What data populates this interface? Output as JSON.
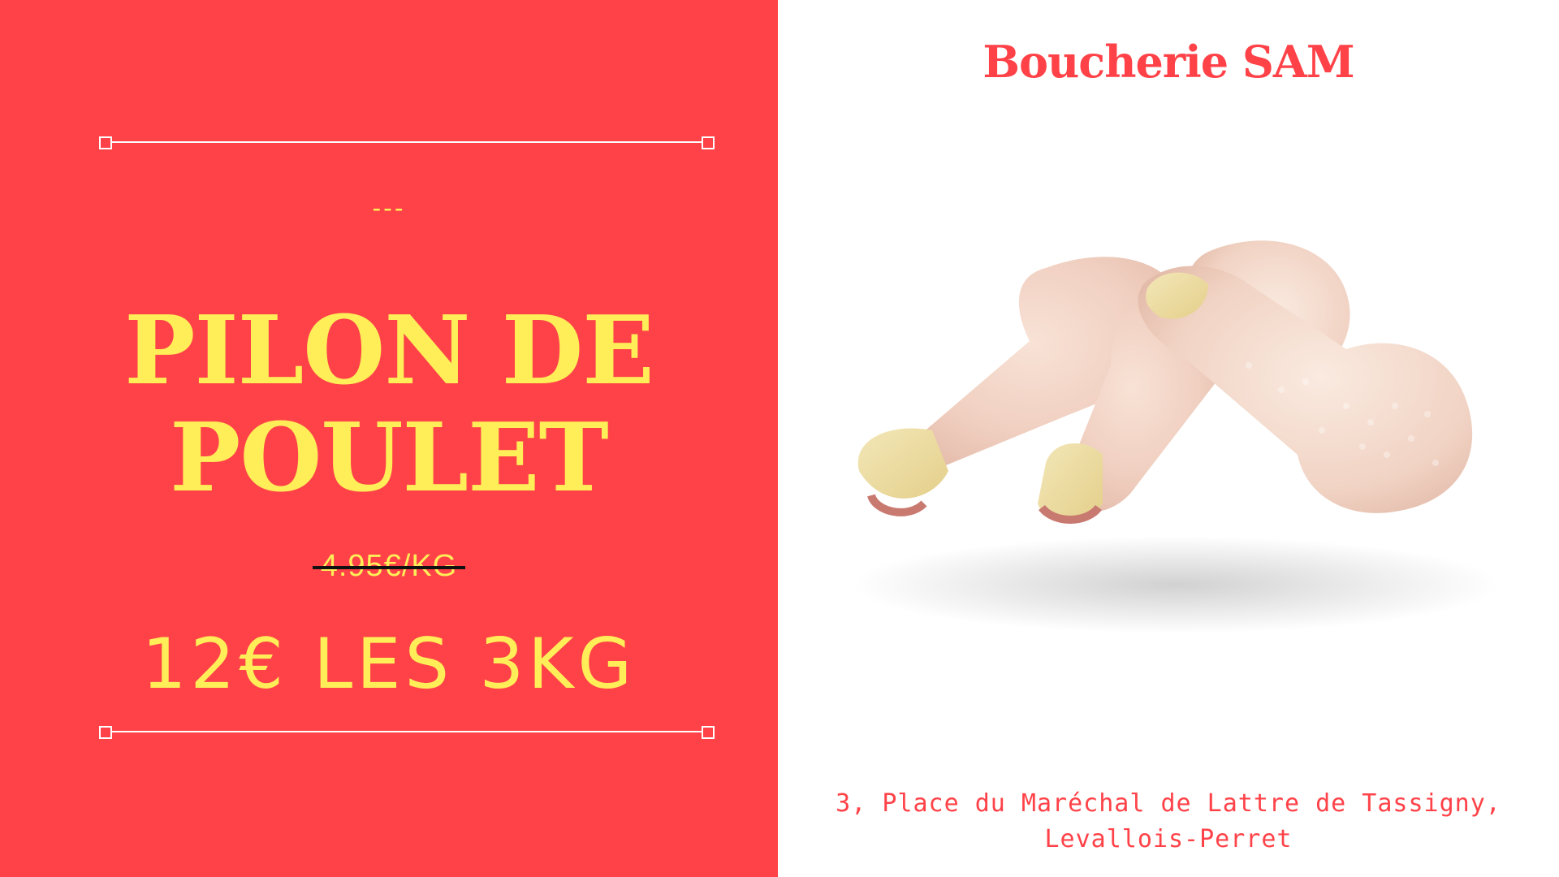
{
  "promo": {
    "dashes": "---",
    "title_line1": "PILON DE",
    "title_line2": "POULET",
    "old_price": "4.95€/KG",
    "new_price": "12€ LES 3KG"
  },
  "shop": {
    "name": "Boucherie SAM",
    "address_line1": "3, Place du Maréchal de Lattre de Tassigny,",
    "address_line2": "Levallois-Perret"
  },
  "colors": {
    "brand_red": "#ff4248",
    "accent_yellow": "#ffee58"
  },
  "image": {
    "subject": "chicken-drumsticks-photo"
  }
}
